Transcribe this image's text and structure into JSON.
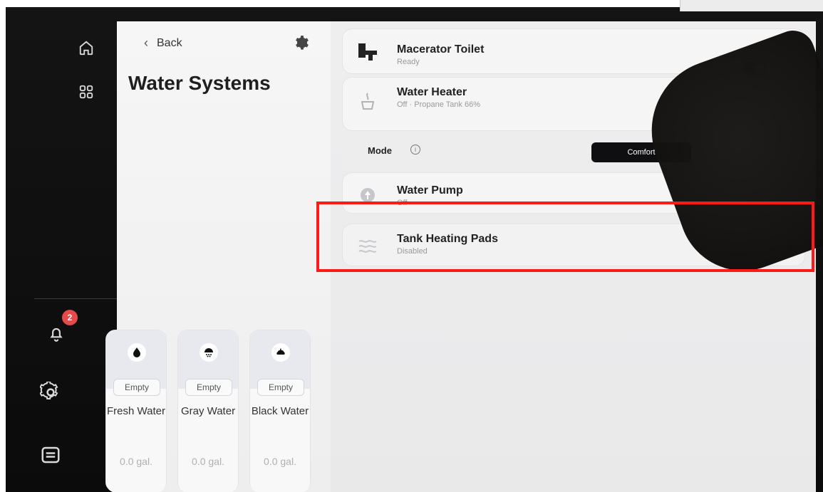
{
  "rail": {
    "icons": [
      "home-icon",
      "grid-icon",
      "bell-icon",
      "gear-icon",
      "panel-icon"
    ],
    "notifications_count": "2"
  },
  "header": {
    "back_label": "Back",
    "settings_icon": "gear-icon"
  },
  "page": {
    "title": "Water Systems"
  },
  "tanks": [
    {
      "name": "Fresh Water",
      "status": "Empty",
      "gallons": "0.0 gal.",
      "icon": "drop-icon"
    },
    {
      "name": "Gray Water",
      "status": "Empty",
      "gallons": "0.0 gal.",
      "icon": "shower-icon"
    },
    {
      "name": "Black Water",
      "status": "Empty",
      "gallons": "0.0 gal.",
      "icon": "waste-icon"
    }
  ],
  "systems": {
    "macerator": {
      "title": "Macerator Toilet",
      "status": "Ready",
      "toggle_on": true,
      "icon": "toilet-icon"
    },
    "water_heater": {
      "title": "Water Heater",
      "status": "Off · Propane Tank 66%",
      "icon": "heater-icon"
    },
    "mode": {
      "label": "Mode",
      "selected": "Comfort",
      "info_icon": "info-icon"
    },
    "water_pump": {
      "title": "Water Pump",
      "status": "Off",
      "icon": "pump-icon"
    },
    "tank_heating_pads": {
      "title": "Tank Heating Pads",
      "status": "Disabled",
      "toggle_on": false,
      "icon": "heat-waves-icon"
    }
  },
  "colors": {
    "toggle_on": "#5fbf73",
    "toggle_off": "#d5d5d8",
    "highlight": "#ff1a1a",
    "badge": "#e74a4a",
    "mode_button": "#0f0f12"
  }
}
